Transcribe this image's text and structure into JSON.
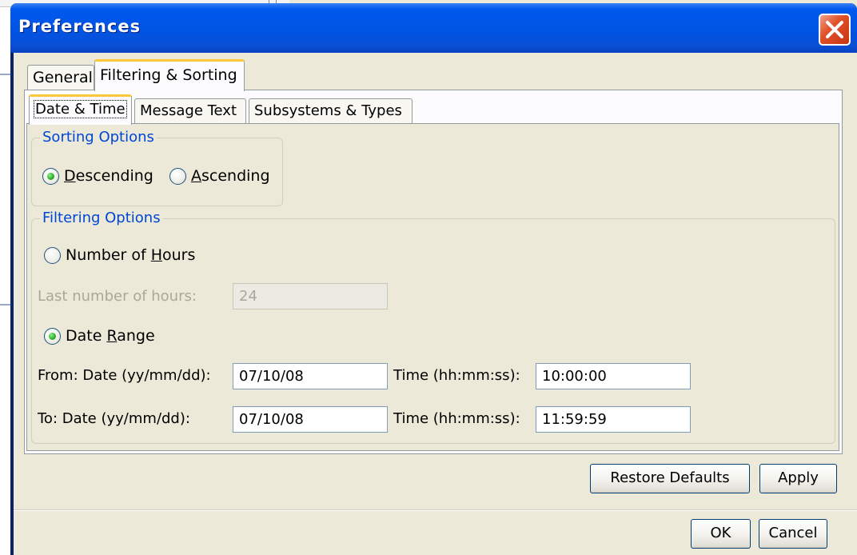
{
  "window": {
    "title": "Preferences"
  },
  "tabs": [
    {
      "label": "General",
      "active": false
    },
    {
      "label": "Filtering & Sorting",
      "active": true
    }
  ],
  "subtabs": [
    {
      "label": "Date & Time",
      "active": true
    },
    {
      "label": "Message Text",
      "active": false
    },
    {
      "label": "Subsystems & Types",
      "active": false
    }
  ],
  "sorting": {
    "legend": "Sorting Options",
    "descending": {
      "label_pre": "",
      "mnemonic": "D",
      "label_post": "escending",
      "selected": true
    },
    "ascending": {
      "label_pre": "",
      "mnemonic": "A",
      "label_post": "scending",
      "selected": false
    }
  },
  "filtering": {
    "legend": "Filtering Options",
    "hours_radio": {
      "label_pre": "Number of ",
      "mnemonic": "H",
      "label_post": "ours",
      "selected": false
    },
    "last_hours_label": "Last number of hours:",
    "last_hours_value": "24",
    "range_radio": {
      "label_pre": "Date ",
      "mnemonic": "R",
      "label_post": "ange",
      "selected": true
    },
    "from": {
      "label": "From:  Date (yy/mm/dd):",
      "date": "07/10/08",
      "time_label": "Time (hh:mm:ss):",
      "time": "10:00:00"
    },
    "to": {
      "label": "To:  Date (yy/mm/dd):",
      "date": "07/10/08",
      "time_label": "Time (hh:mm:ss):",
      "time": "11:59:59"
    }
  },
  "buttons": {
    "restore": "Restore Defaults",
    "apply": "Apply",
    "ok": "OK",
    "cancel": "Cancel"
  },
  "colors": {
    "title_bar": "#0054e3",
    "legend_text": "#0046d5",
    "active_tab_accent": "#ffc83c",
    "close_button": "#e0522a"
  }
}
